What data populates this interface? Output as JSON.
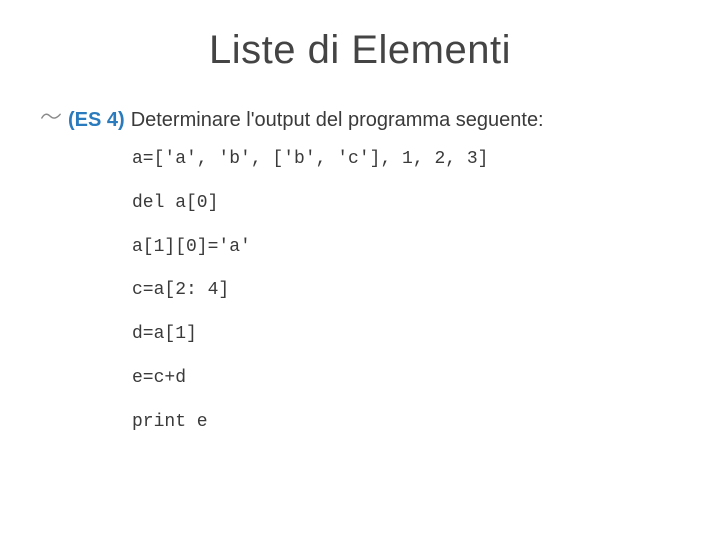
{
  "title": "Liste di Elementi",
  "exercise": {
    "label": "(ES 4)",
    "prompt": "Determinare l'output del programma seguente:"
  },
  "code": {
    "lines": [
      "a=['a', 'b', ['b', 'c'], 1, 2, 3]",
      "del a[0]",
      "a[1][0]='a'",
      "c=a[2: 4]",
      "d=a[1]",
      "e=c+d",
      "print e"
    ]
  }
}
